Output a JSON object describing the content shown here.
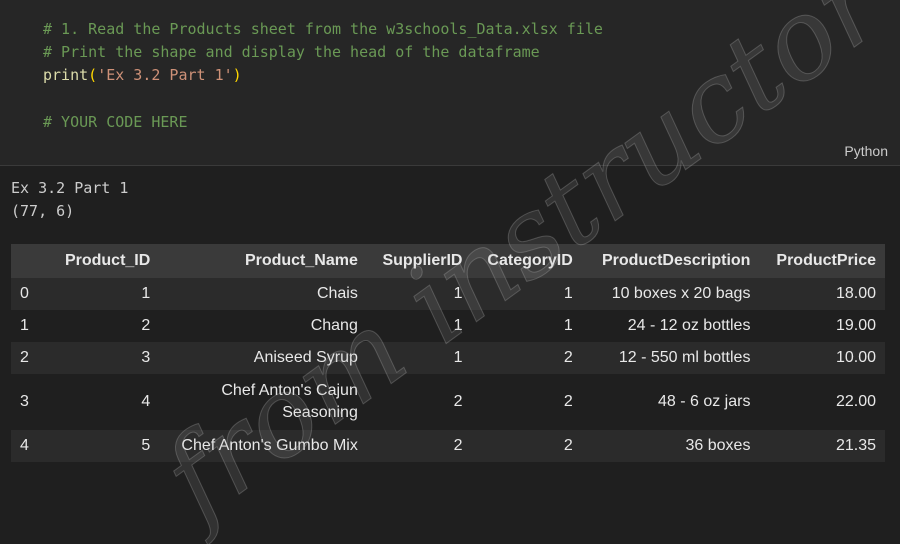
{
  "code": {
    "comment1": "# 1. Read the Products sheet from the w3schools_Data.xlsx file",
    "comment2": "# Print the shape and display the head of the dataframe",
    "print_fn": "print",
    "print_open": "(",
    "print_arg": "'Ex 3.2 Part 1'",
    "print_close": ")",
    "comment3": "# YOUR CODE HERE",
    "language": "Python"
  },
  "output": {
    "line1": "Ex 3.2 Part 1",
    "line2": "(77, 6)"
  },
  "table": {
    "columns": [
      "",
      "Product_ID",
      "Product_Name",
      "SupplierID",
      "CategoryID",
      "ProductDescription",
      "ProductPrice"
    ],
    "rows": [
      [
        "0",
        "1",
        "Chais",
        "1",
        "1",
        "10 boxes x 20 bags",
        "18.00"
      ],
      [
        "1",
        "2",
        "Chang",
        "1",
        "1",
        "24 - 12 oz bottles",
        "19.00"
      ],
      [
        "2",
        "3",
        "Aniseed Syrup",
        "1",
        "2",
        "12 - 550 ml bottles",
        "10.00"
      ],
      [
        "3",
        "4",
        "Chef Anton's Cajun Seasoning",
        "2",
        "2",
        "48 - 6 oz jars",
        "22.00"
      ],
      [
        "4",
        "5",
        "Chef Anton's Gumbo Mix",
        "2",
        "2",
        "36 boxes",
        "21.35"
      ]
    ]
  },
  "watermark": "from instructor"
}
